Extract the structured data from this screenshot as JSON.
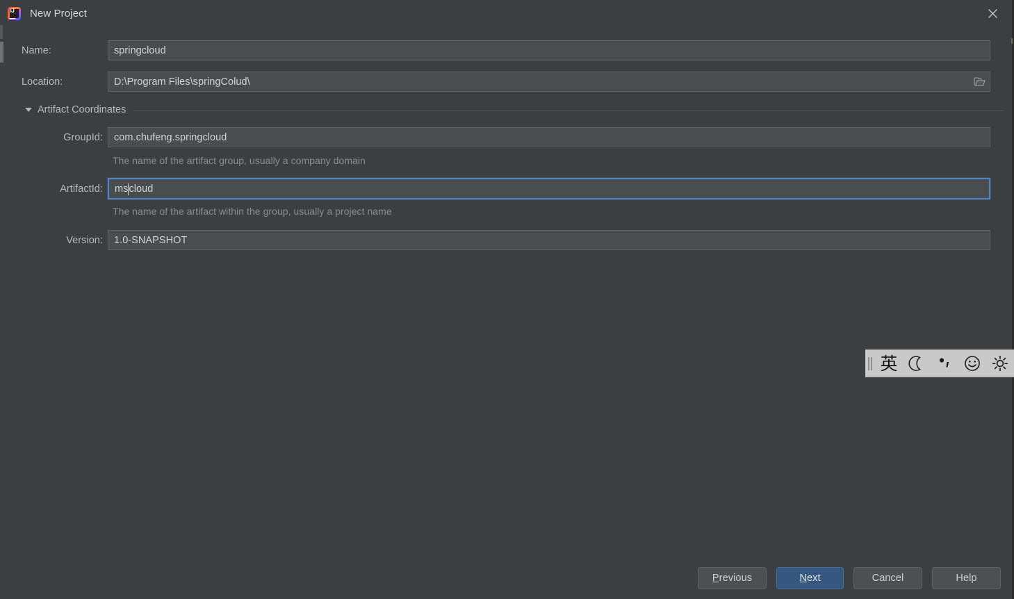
{
  "window": {
    "title": "New Project",
    "app_icon": "intellij-idea-logo",
    "close_icon": "close-icon"
  },
  "form": {
    "name": {
      "label": "Name:",
      "value": "springcloud",
      "placeholder": ""
    },
    "location": {
      "label": "Location:",
      "value": "D:\\Program Files\\springColud\\",
      "placeholder": "",
      "browse_icon": "folder-open-icon"
    },
    "artifact_coordinates": {
      "label": "Artifact Coordinates",
      "expanded": true,
      "collapse_icon": "triangle-down-icon",
      "group_id": {
        "label": "GroupId:",
        "value": "com.chufeng.springcloud",
        "hint": "The name of the artifact group, usually a company domain"
      },
      "artifact_id": {
        "label": "ArtifactId:",
        "value_before_caret": "ms",
        "value_after_caret": "cloud",
        "value": "mscloud",
        "hint": "The name of the artifact within the group, usually a project name",
        "focused": true
      },
      "version": {
        "label": "Version:",
        "value": "1.0-SNAPSHOT"
      }
    }
  },
  "buttons": {
    "previous": {
      "label_pre": "",
      "mnemonic": "P",
      "label_post": "revious"
    },
    "next": {
      "label_pre": "",
      "mnemonic": "N",
      "label_post": "ext",
      "primary": true
    },
    "cancel": {
      "label": "Cancel"
    },
    "help": {
      "label": "Help"
    }
  },
  "ime_toolbar": {
    "grip_icon": "drag-grip-icon",
    "mode_label": "英",
    "items": [
      {
        "icon": "crescent-moon-icon"
      },
      {
        "icon": "punctuation-icon"
      },
      {
        "icon": "smiley-face-icon"
      },
      {
        "icon": "gear-icon"
      }
    ]
  },
  "colors": {
    "dialog_bg": "#3c3f41",
    "field_bg": "#494d50",
    "focus_border": "#4f87c4",
    "primary_button": "#365880",
    "ime_bg": "#c9c9c9"
  }
}
